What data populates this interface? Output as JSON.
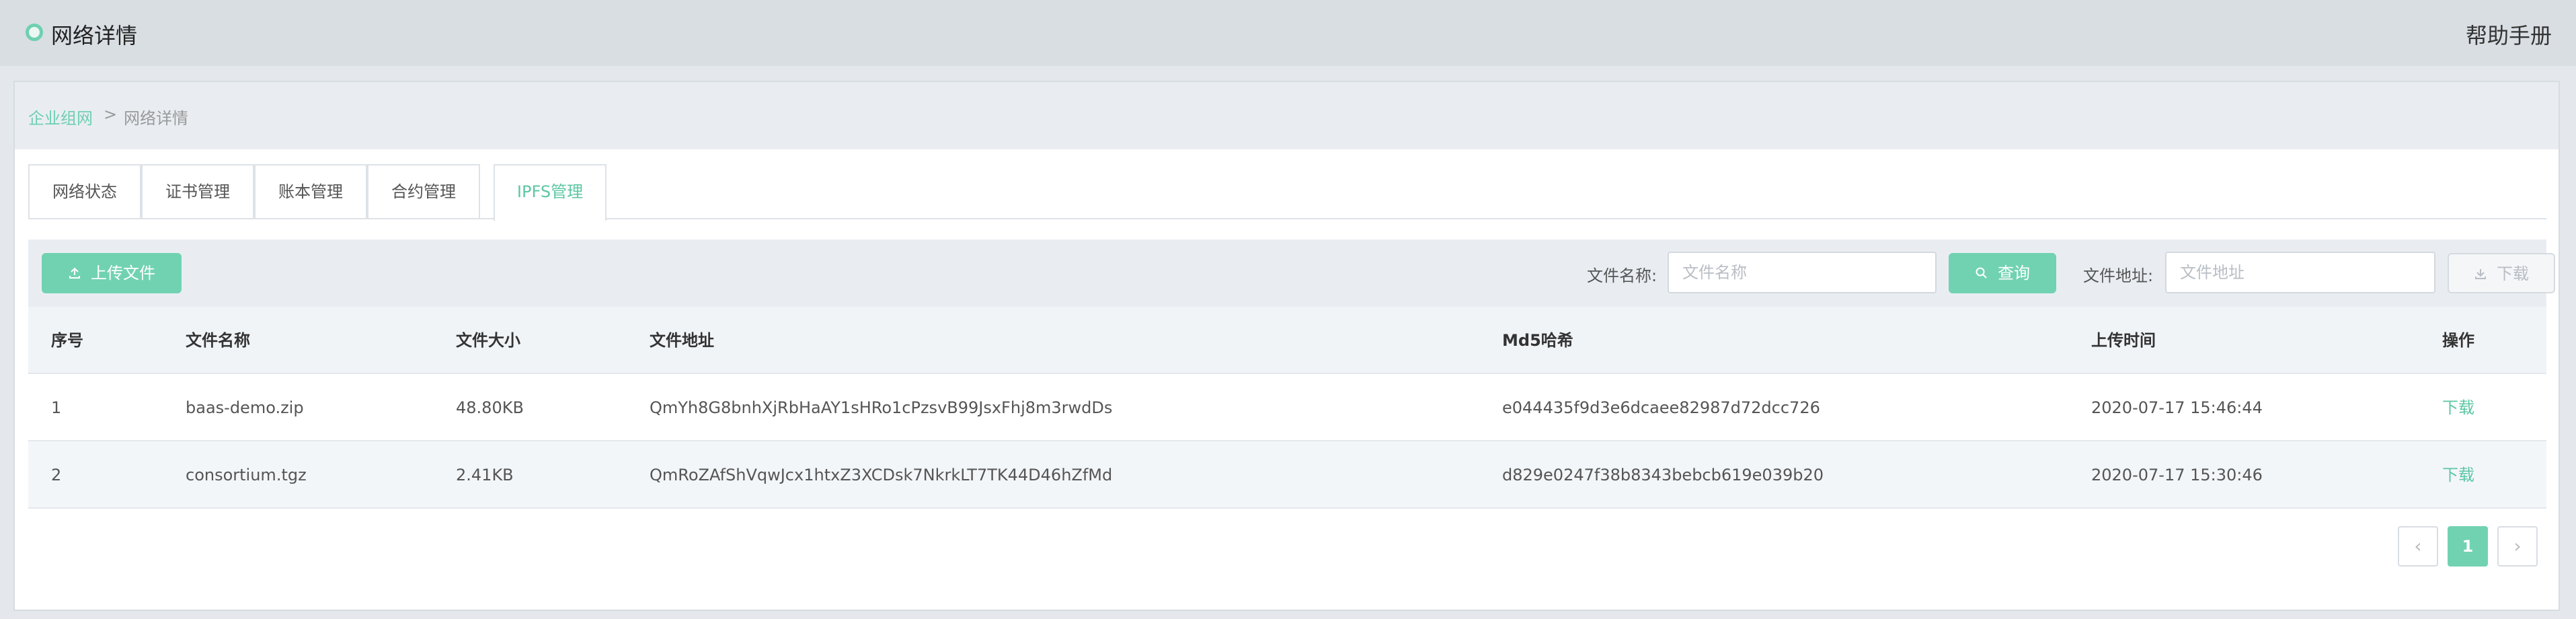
{
  "header": {
    "title": "网络详情",
    "help": "帮助手册"
  },
  "breadcrumb": {
    "root": "企业组网",
    "separator": ">",
    "current": "网络详情"
  },
  "tabs": [
    {
      "label": "网络状态"
    },
    {
      "label": "证书管理"
    },
    {
      "label": "账本管理"
    },
    {
      "label": "合约管理"
    },
    {
      "label": "IPFS管理",
      "active": true
    }
  ],
  "toolbar": {
    "upload_label": "上传文件",
    "file_name_label": "文件名称:",
    "file_name_placeholder": "文件名称",
    "search_label": "查询",
    "file_addr_label": "文件地址:",
    "file_addr_placeholder": "文件地址",
    "download_label": "下载"
  },
  "table": {
    "columns": [
      "序号",
      "文件名称",
      "文件大小",
      "文件地址",
      "Md5哈希",
      "上传时间",
      "操作"
    ],
    "rows": [
      {
        "index": "1",
        "name": "baas-demo.zip",
        "size": "48.80KB",
        "address": "QmYh8G8bnhXjRbHaAY1sHRo1cPzsvB99JsxFhj8m3rwdDs",
        "md5": "e044435f9d3e6dcaee82987d72dcc726",
        "time": "2020-07-17 15:46:44",
        "action": "下载"
      },
      {
        "index": "2",
        "name": "consortium.tgz",
        "size": "2.41KB",
        "address": "QmRoZAfShVqwJcx1htxZ3XCDsk7NkrkLT7TK44D46hZfMd",
        "md5": "d829e0247f38b8343bebcb619e039b20",
        "time": "2020-07-17 15:30:46",
        "action": "下载"
      }
    ]
  },
  "pagination": {
    "prev": "‹",
    "current_page": "1",
    "next": "›"
  },
  "colors": {
    "accent": "#71d2b2",
    "accent_text": "#5cc7a4",
    "header_bg": "#d9dee3"
  },
  "icons": {
    "upload": "upload-icon",
    "search": "search-icon",
    "download": "download-icon"
  }
}
